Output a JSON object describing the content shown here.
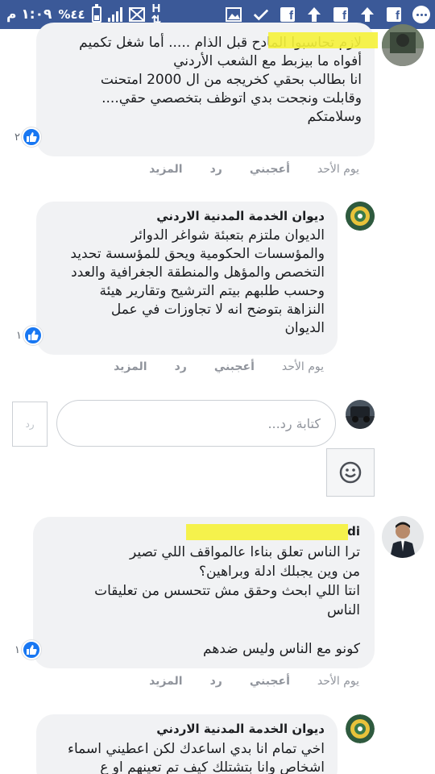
{
  "status_bar": {
    "time": "١:٠٩ م",
    "battery_percent": "%٤٤",
    "battery_level": 0.44,
    "notification_icons": [
      "signal-icon",
      "message-icon",
      "h-network-icon",
      "image-icon",
      "check-icon",
      "facebook-icon",
      "tree-icon",
      "facebook-icon",
      "tree-icon",
      "facebook-icon",
      "more-icon"
    ]
  },
  "comments": [
    {
      "author": "",
      "body": "لازم تحاسبوا المادح قبل الذام ..... أما شغل تكميم\nأفواه ما بيزبط مع الشعب الأردني\nانا بطالب بحقي كخريجه من ال 2000 امتحنت\nوقابلت ونجحت بدي اتوظف بتخصصي حقي....\nوسلامتكم",
      "likes": "٢",
      "time": "يوم الأحد",
      "like_label": "أعجبني",
      "reply_label": "رد",
      "more_label": "المزيد"
    },
    {
      "author": "ديوان الخدمة المدنية الاردني",
      "body": "الديوان ملتزم بتعبئة شواغر الدوائر\nوالمؤسسات الحكومية ويحق للمؤسسة تحديد\nالتخصص والمؤهل والمنطقة الجغرافية والعدد\nوحسب طلبهم بيتم الترشيح وتقارير هيئة\nالنزاهة بتوضح انه لا تجاوزات في عمل\nالديوان",
      "likes": "١",
      "time": "يوم الأحد",
      "like_label": "أعجبني",
      "reply_label": "رد",
      "more_label": "المزيد"
    },
    {
      "author": "di",
      "body": "ترا الناس تعلق بناءا عالمواقف اللي تصير\nمن وين يجبلك ادلة وبراهين؟\nانتا اللي ابحث وحقق مش تتحسس من تعليقات\nالناس\n\nكونو مع الناس وليس ضدهم",
      "likes": "١",
      "time": "يوم الأحد",
      "like_label": "أعجبني",
      "reply_label": "رد",
      "more_label": "المزيد"
    },
    {
      "author": "ديوان الخدمة المدنية الاردني",
      "body": "اخي تمام انا بدي اساعدك لكن اعطيني اسماء\nاشخاص وانا بتشتلك كيف تم تعينهم او ع"
    }
  ],
  "reply_box": {
    "placeholder": "كتابة رد...",
    "send_label": "رد"
  },
  "colors": {
    "status_bar": "#3b5998",
    "bubble": "#f1f2f4",
    "like_blue": "#1877f2",
    "redaction": "#f5f23a"
  }
}
